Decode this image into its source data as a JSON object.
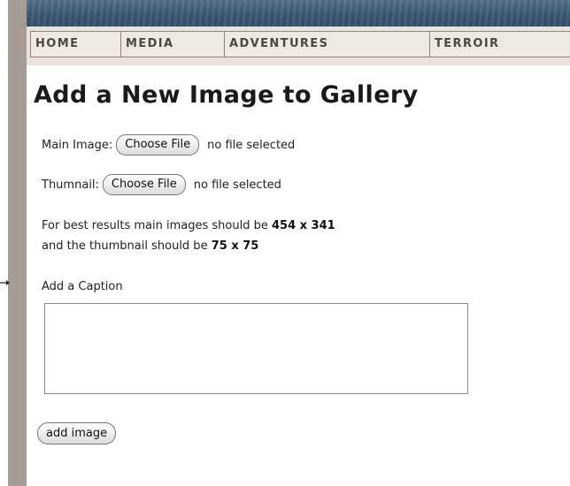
{
  "colors": {
    "border_strip": "#a69c94",
    "nav_background": "#eae3db",
    "nav_text": "#4e4740",
    "banner": "#3c5873"
  },
  "nav": {
    "items": [
      {
        "label": "HOME"
      },
      {
        "label": "MEDIA"
      },
      {
        "label": "ADVENTURES"
      },
      {
        "label": "TERROIR"
      }
    ]
  },
  "form": {
    "title": "Add a New Image to Gallery",
    "main_image": {
      "label": "Main Image:",
      "button": "Choose File",
      "status": "no file selected"
    },
    "thumbnail": {
      "label": "Thumnail:",
      "button": "Choose File",
      "status": "no file selected"
    },
    "hint": {
      "line1_prefix": "For best results main images should be ",
      "main_size": "454 x 341",
      "line2_prefix": "and the thumbnail should be ",
      "thumb_size": "75 x 75"
    },
    "caption": {
      "label": "Add a Caption",
      "value": ""
    },
    "submit": "add image"
  },
  "icons": {
    "left_marker": "arrow-right-icon"
  }
}
